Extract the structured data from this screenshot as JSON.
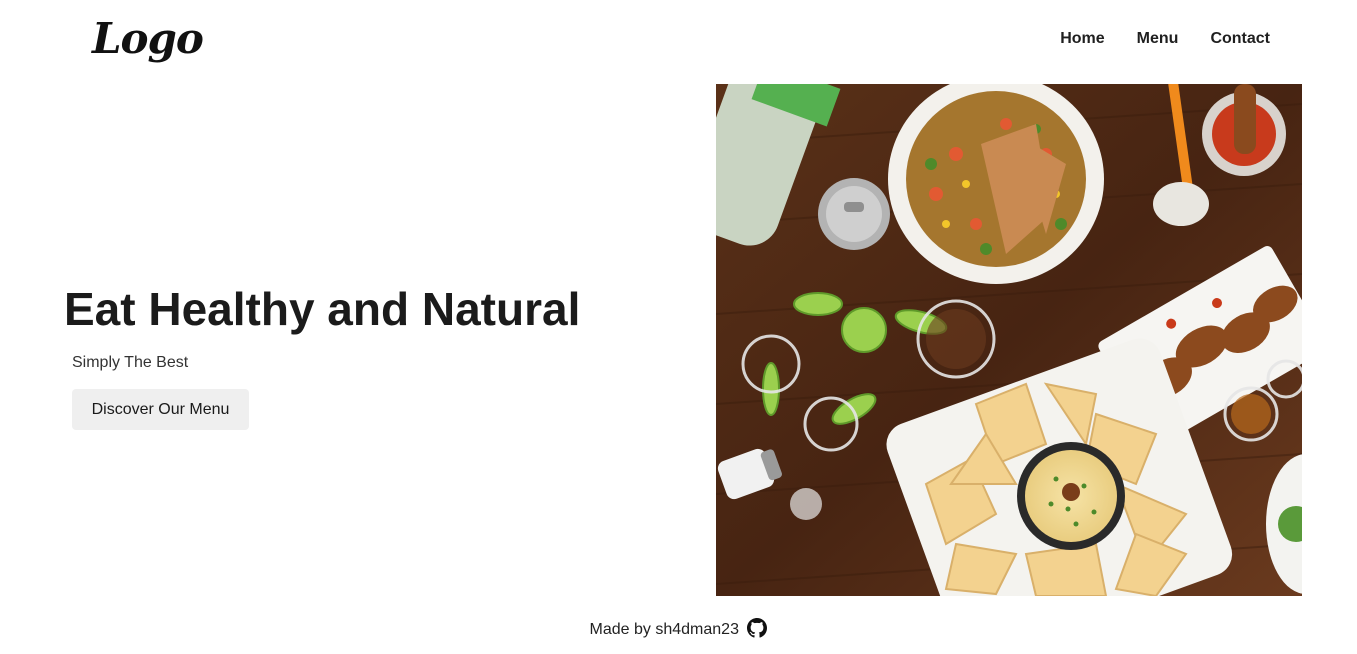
{
  "header": {
    "logo_text": "Logo",
    "nav": [
      {
        "label": "Home"
      },
      {
        "label": "Menu"
      },
      {
        "label": "Contact"
      }
    ]
  },
  "hero": {
    "title": "Eat Healthy and Natural",
    "subtitle": "Simply The Best",
    "cta_label": "Discover Our Menu"
  },
  "footer": {
    "made_by": "Made by sh4dman23",
    "icon": "github-icon"
  }
}
